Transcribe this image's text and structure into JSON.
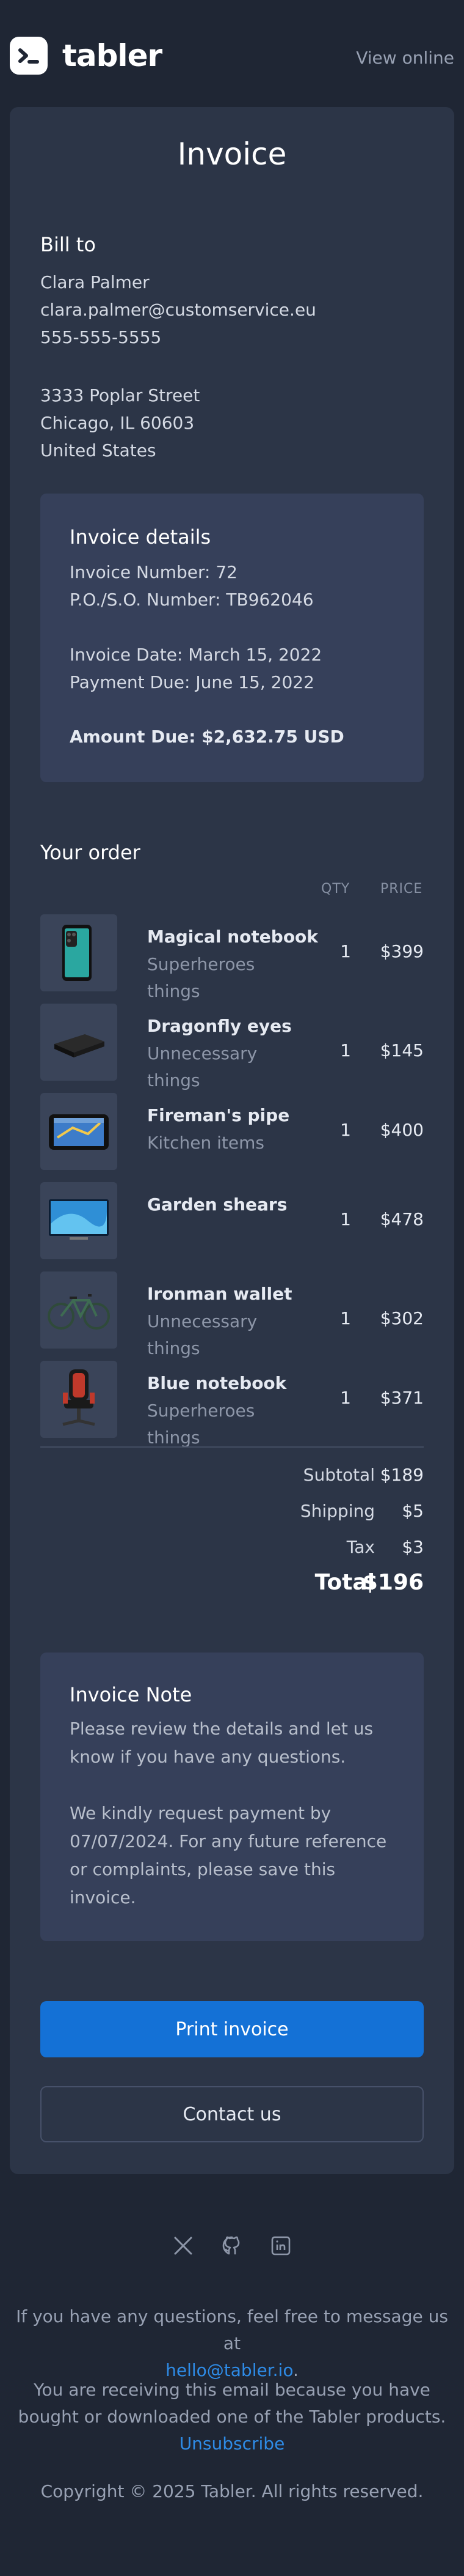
{
  "brand": {
    "name": "tabler"
  },
  "header": {
    "view_online": "View online"
  },
  "invoice": {
    "title": "Invoice",
    "bill_to_heading": "Bill to",
    "name": "Clara Palmer",
    "email": "clara.palmer@customservice.eu",
    "phone": "555-555-5555",
    "address_line1": "3333 Poplar Street",
    "address_line2": "Chicago, IL 60603",
    "country": "United States"
  },
  "details": {
    "heading": "Invoice details",
    "invoice_number": "Invoice Number: 72",
    "po_number": "P.O./S.O. Number: TB962046",
    "invoice_date": "Invoice Date: March 15, 2022",
    "payment_due": "Payment Due: June 15, 2022",
    "amount_due": "Amount Due: $2,632.75 USD"
  },
  "order": {
    "heading": "Your order",
    "col_qty": "QTY",
    "col_price": "PRICE",
    "items": [
      {
        "name": "Magical notebook",
        "category": "Superheroes things",
        "qty": "1",
        "price": "$399",
        "icon": "smartphone-icon"
      },
      {
        "name": "Dragonfly eyes",
        "category": "Unnecessary things",
        "qty": "1",
        "price": "$145",
        "icon": "device-icon"
      },
      {
        "name": "Fireman's pipe",
        "category": "Kitchen items",
        "qty": "1",
        "price": "$400",
        "icon": "gps-navigator-icon"
      },
      {
        "name": "Garden shears",
        "category": "",
        "qty": "1",
        "price": "$478",
        "icon": "tv-icon"
      },
      {
        "name": "Ironman wallet",
        "category": "Unnecessary things",
        "qty": "1",
        "price": "$302",
        "icon": "bicycle-icon"
      },
      {
        "name": "Blue notebook",
        "category": "Superheroes things",
        "qty": "1",
        "price": "$371",
        "icon": "gaming-chair-icon"
      }
    ]
  },
  "totals": {
    "subtotal_label": "Subtotal",
    "subtotal": "$189",
    "shipping_label": "Shipping",
    "shipping": "$5",
    "tax_label": "Tax",
    "tax": "$3",
    "total_label": "Total",
    "total": "$196"
  },
  "note": {
    "heading": "Invoice Note",
    "p1": "Please review the details and let us know if you have any questions.",
    "p2": "We kindly request payment by 07/07/2024. For any future reference or complaints, please save this invoice."
  },
  "actions": {
    "print": "Print invoice",
    "contact": "Contact us"
  },
  "footer": {
    "social": [
      "x-icon",
      "github-icon",
      "linkedin-icon"
    ],
    "questions_text": "If you have any questions, feel free to message us at",
    "email_link": "hello@tabler.io",
    "period": ".",
    "receiving_text": "You are receiving this email because you have bought or downloaded one of the Tabler products.",
    "unsubscribe": "Unsubscribe",
    "copyright": "Copyright © 2025 Tabler. All rights reserved."
  },
  "colors": {
    "background": "#1f2634",
    "card": "#2c3547",
    "panel": "#36405a",
    "accent": "#1471d6",
    "link": "#2e8be6"
  }
}
